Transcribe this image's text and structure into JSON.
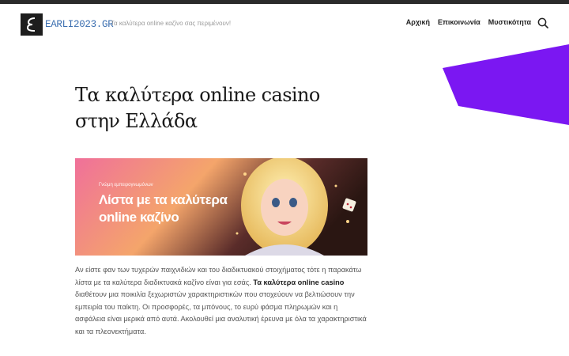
{
  "site": {
    "logo_text": "EARLI2023.GR",
    "tagline": "Τα καλύτερα online καζίνο σας περιμένουν!"
  },
  "nav": {
    "items": [
      {
        "label": "Αρχική"
      },
      {
        "label": "Επικοινωνία"
      },
      {
        "label": "Μυστικότητα"
      }
    ]
  },
  "article": {
    "title": "Τα καλύτερα online casino στην Ελλάδα",
    "banner": {
      "small_text": "Γνώμη εμπειρογνωμόνων",
      "headline": "Λίστα με τα καλύτερα online καζίνο"
    },
    "intro": {
      "part1": "Αν είστε φαν των τυχερών παιχνιδιών και του διαδικτυακού στοιχήματος τότε η παρακάτω λίστα με τα καλύτερα διαδικτυακά καζίνο είναι για εσάς. ",
      "bold": "Τα καλύτερα online casino",
      "part2": " διαθέτουν μια ποικιλία ξεχωριστών χαρακτηριστικών που στοχεύουν να βελτιώσουν την εμπειρία του παίκτη. Οι προσφορές, τα μπόνους, το ευρύ φάσμα πληρωμών και η ασφάλεια είναι μερικά από αυτά. Ακολουθεί μια αναλυτική έρευνα με όλα τα χαρακτηριστικά και τα πλεονεκτήματα."
    }
  },
  "colors": {
    "accent_purple": "#7b17f2",
    "logo_blue": "#3c6fb0",
    "banner_pink": "#f0709a",
    "banner_orange": "#f4a56b"
  },
  "icons": {
    "search": "search-icon",
    "logo": "epsilon-logo-icon"
  }
}
